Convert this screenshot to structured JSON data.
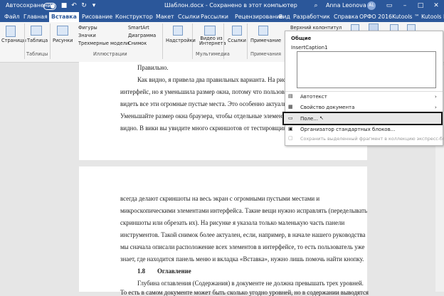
{
  "titlebar": {
    "autosave": "Автосохранение",
    "doc_title": "Шаблон.docx  -  Сохранено в этот компьютер",
    "user": "Anna Leonova",
    "avatar": "AL"
  },
  "tabs": [
    "Файл",
    "Главная",
    "Вставка",
    "Рисование",
    "Конструктор",
    "Макет",
    "Ссылки",
    "Рассылки",
    "Рецензирование",
    "Вид",
    "Разработчик",
    "Справка",
    "ОРФО 2016",
    "Kutools ™",
    "Kutools Plus"
  ],
  "ribbon": {
    "pages": "Страницы",
    "table": "Таблица",
    "tables_group": "Таблицы",
    "pictures": "Рисунки",
    "shapes": "Фигуры",
    "icons": "Значки",
    "models": "Трехмерные модели",
    "smartart": "SmartArt",
    "chart": "Диаграмма",
    "snapshot": "Снимок",
    "illustrations_group": "Иллюстрации",
    "addins": "Надстройки",
    "video": "Видео из Интернета",
    "multimedia_group": "Мультимедиа",
    "links": "Ссылки",
    "comment": "Примечание",
    "comments_group": "Примечания",
    "header": "Верхний колонтитул"
  },
  "dropdown": {
    "header": "Общие",
    "caption": "InsertCaption1",
    "autotext": "Автотекст",
    "docprop": "Свойство документа",
    "field": "Поле...",
    "organizer": "Организатор стандартных блоков...",
    "save_selection": "Сохранить выделенный фрагмент в коллекцию экспресс-блоков..."
  },
  "document": {
    "page1": [
      "Правильно.",
      "Как видно, я привела два правильных варианта. На рисун",
      "интерфейс, но я уменьшила размер окна, потому что пользовател",
      "видеть все эти огромные пустые места. Это особенно актуаль",
      "Уменьшайте размер окна браузера, чтобы отдельные элементы",
      "видно. В вики вы увидите много скриншотов от тестировщик"
    ],
    "page2": [
      "всегда  делают  скриншоты  на  весь  экран  с  огромными  пустыми  местами  и",
      "микроскопическими элементами интерфейса. Такие вещи нужно исправлять (переделывать",
      "скриншоты или обрезать их). На рисунке я указала только маленькую часть панели",
      "инструментов. Такой снимок более актуален, если, например, в начале нашего руководства",
      "мы сначала описали расположение всех элементов в интерфейсе, то есть пользователь уже",
      "знает, где находится панель меню и вкладка «Вставка», нужно лишь помочь найти кнопку."
    ],
    "section_number": "1.8",
    "section_title": "Оглавление",
    "page2b": [
      "Глубина оглавления (Содержания) в документе не должна превышать трех уровней.",
      "То есть в самом документе может быть сколько угодно уровней, но в содержании выводятся",
      "только заголовки 1–3-го уровней."
    ]
  }
}
